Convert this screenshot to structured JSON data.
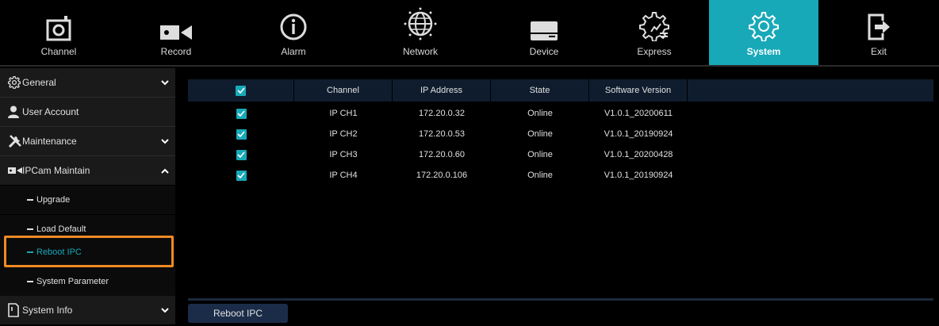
{
  "tabs": [
    {
      "label": "Channel",
      "icon": "channel-icon"
    },
    {
      "label": "Record",
      "icon": "record-icon"
    },
    {
      "label": "Alarm",
      "icon": "alarm-icon"
    },
    {
      "label": "Network",
      "icon": "network-icon"
    },
    {
      "label": "Device",
      "icon": "device-icon"
    },
    {
      "label": "Express",
      "icon": "express-icon"
    },
    {
      "label": "System",
      "icon": "system-icon",
      "active": true
    },
    {
      "label": "Exit",
      "icon": "exit-icon"
    }
  ],
  "sidebar": {
    "items": [
      {
        "label": "General",
        "icon": "gear-icon",
        "chevron": "down"
      },
      {
        "label": "User Account",
        "icon": "user-icon"
      },
      {
        "label": "Maintenance",
        "icon": "tools-icon",
        "chevron": "down"
      },
      {
        "label": "IPCam Maintain",
        "icon": "camera-icon",
        "chevron": "up"
      },
      {
        "label": "Upgrade"
      },
      {
        "label": "Load Default"
      },
      {
        "label": "Reboot IPC",
        "selected": true
      },
      {
        "label": "System Parameter"
      },
      {
        "label": "System Info",
        "icon": "info-icon",
        "chevron": "down"
      }
    ]
  },
  "table": {
    "headers": [
      "Channel",
      "IP Address",
      "State",
      "Software Version"
    ],
    "header_checked": true,
    "rows": [
      {
        "checked": true,
        "channel": "IP CH1",
        "ip": "172.20.0.32",
        "state": "Online",
        "version": "V1.0.1_20200611"
      },
      {
        "checked": true,
        "channel": "IP CH2",
        "ip": "172.20.0.53",
        "state": "Online",
        "version": "V1.0.1_20190924"
      },
      {
        "checked": true,
        "channel": "IP CH3",
        "ip": "172.20.0.60",
        "state": "Online",
        "version": "V1.0.1_20200428"
      },
      {
        "checked": true,
        "channel": "IP CH4",
        "ip": "172.20.0.106",
        "state": "Online",
        "version": "V1.0.1_20190924"
      }
    ]
  },
  "actions": {
    "reboot_label": "Reboot IPC"
  },
  "colors": {
    "accent": "#17a9b8",
    "highlight": "#f08a24",
    "header_bg": "#0f1c2e",
    "button_bg": "#1a2c48"
  }
}
